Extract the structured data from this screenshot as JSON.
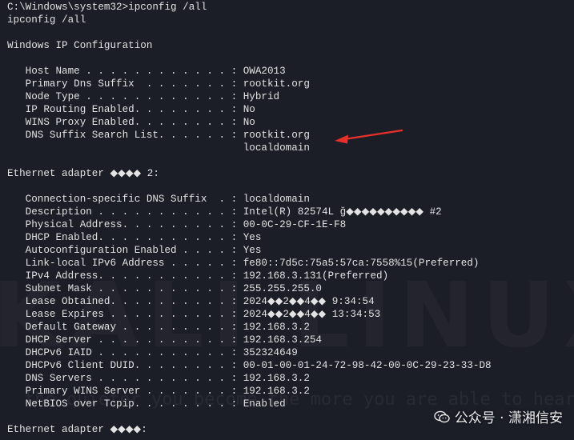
{
  "window": {
    "background_color": "#1b1d27",
    "text_color": "#e3e3e3",
    "accent_color": "#e8302a"
  },
  "terminal": {
    "lines": [
      "C:\\Windows\\system32>ipconfig /all",
      "ipconfig /all",
      "",
      "Windows IP Configuration",
      "",
      "   Host Name . . . . . . . . . . . . : OWA2013",
      "   Primary Dns Suffix  . . . . . . . : rootkit.org",
      "   Node Type . . . . . . . . . . . . : Hybrid",
      "   IP Routing Enabled. . . . . . . . : No",
      "   WINS Proxy Enabled. . . . . . . . : No",
      "   DNS Suffix Search List. . . . . . : rootkit.org",
      "                                       localdomain",
      "",
      "Ethernet adapter ◆◆◆◆ 2:",
      "",
      "   Connection-specific DNS Suffix  . : localdomain",
      "   Description . . . . . . . . . . . : Intel(R) 82574L ğ◆◆◆◆◆◆◆◆◆◆ #2",
      "   Physical Address. . . . . . . . . : 00-0C-29-CF-1E-F8",
      "   DHCP Enabled. . . . . . . . . . . : Yes",
      "   Autoconfiguration Enabled . . . . : Yes",
      "   Link-local IPv6 Address . . . . . : fe80::7d5c:75a5:57ca:7558%15(Preferred)",
      "   IPv4 Address. . . . . . . . . . . : 192.168.3.131(Preferred)",
      "   Subnet Mask . . . . . . . . . . . : 255.255.255.0",
      "   Lease Obtained. . . . . . . . . . : 2024◆◆2◆◆4◆◆ 9:34:54",
      "   Lease Expires . . . . . . . . . . : 2024◆◆2◆◆4◆◆ 13:34:53",
      "   Default Gateway . . . . . . . . . : 192.168.3.2",
      "   DHCP Server . . . . . . . . . . . : 192.168.3.254",
      "   DHCPv6 IAID . . . . . . . . . . . : 352324649",
      "   DHCPv6 Client DUID. . . . . . . . : 00-01-00-01-24-72-98-42-00-0C-29-23-33-D8",
      "   DNS Servers . . . . . . . . . . . : 192.168.3.2",
      "   Primary WINS Server . . . . . . . : 192.168.3.2",
      "   NetBIOS over Tcpip. . . . . . . . : Enabled",
      "",
      "Ethernet adapter ◆◆◆◆:"
    ]
  },
  "annotation": {
    "arrow_icon": "red-arrow-icon"
  },
  "watermark": {
    "background_text": "KALI LINUX",
    "background_quote": "the quieter you become the more you are able to hear",
    "brand_icon": "wechat-icon",
    "brand_text": "公众号 · 潇湘信安"
  }
}
